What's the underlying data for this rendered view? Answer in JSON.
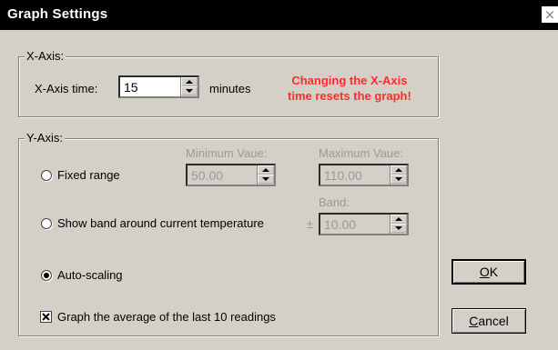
{
  "window": {
    "title": "Graph Settings",
    "close_glyph": "×"
  },
  "x_axis": {
    "legend": "X-Axis:",
    "time_label": "X-Axis time:",
    "time_value": "15",
    "units": "minutes",
    "warning_line1": "Changing the X-Axis",
    "warning_line2": "time resets the graph!",
    "warning_color": "#ff2b2b"
  },
  "y_axis": {
    "legend": "Y-Axis:",
    "fixed_range": {
      "label": "Fixed range",
      "checked": false,
      "min_label": "Minimum Vaue:",
      "min_value": "50.00",
      "max_label": "Maximum Vaue:",
      "max_value": "110.00"
    },
    "show_band": {
      "label": "Show band around current temperature",
      "checked": false,
      "band_label": "Band:",
      "plus_minus": "±",
      "band_value": "10.00"
    },
    "auto_scaling": {
      "label": "Auto-scaling",
      "checked": true
    },
    "average": {
      "label": "Graph the average of the last 10 readings",
      "checked": true
    }
  },
  "buttons": {
    "ok_mnemonic": "O",
    "ok_rest": "K",
    "cancel_mnemonic": "C",
    "cancel_rest": "ancel"
  }
}
